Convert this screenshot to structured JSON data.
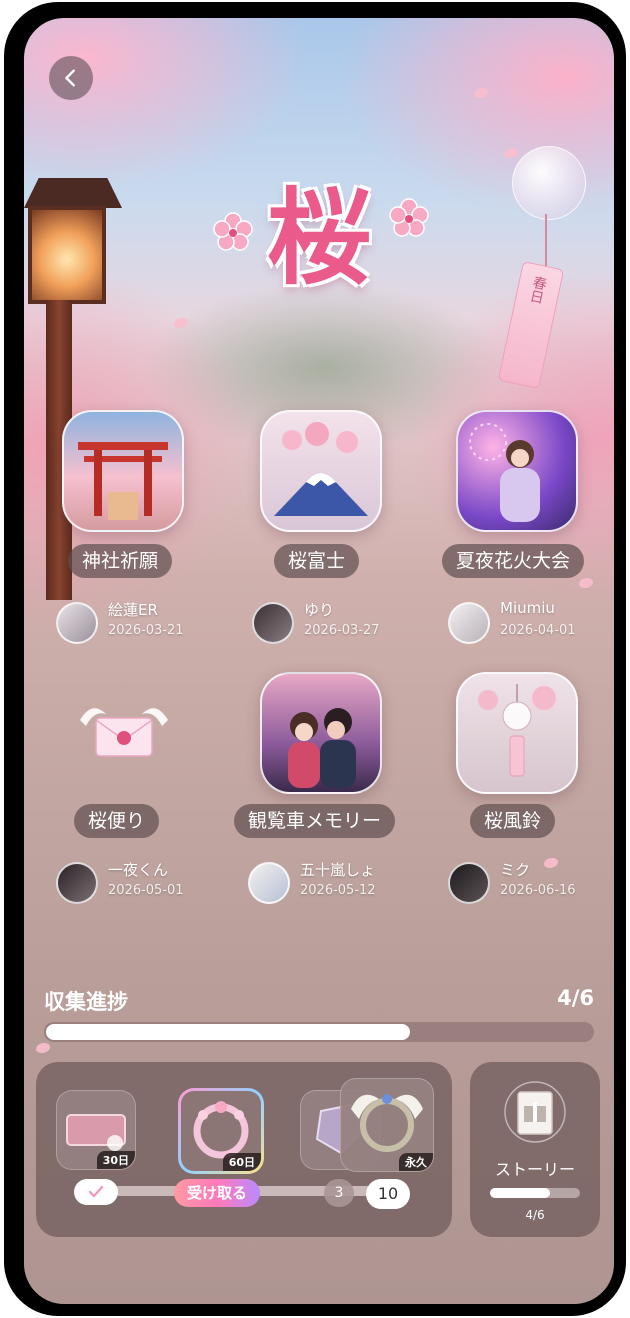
{
  "logo": {
    "text": "桜"
  },
  "decoration": {
    "tanzaku_text": "春日"
  },
  "items": [
    {
      "name": "神社祈願",
      "owner": "絵蓮ER",
      "date": "2026-03-21",
      "icon": "torii-gate-icon"
    },
    {
      "name": "桜富士",
      "owner": "ゆり",
      "date": "2026-03-27",
      "icon": "mount-fuji-icon"
    },
    {
      "name": "夏夜花火大会",
      "owner": "Miumiu",
      "date": "2026-04-01",
      "icon": "fireworks-yukata-icon"
    },
    {
      "name": "桜便り",
      "owner": "一夜くん",
      "date": "2026-05-01",
      "icon": "winged-letter-icon"
    },
    {
      "name": "観覧車メモリー",
      "owner": "五十嵐しょ",
      "date": "2026-05-12",
      "icon": "ferris-wheel-couple-icon"
    },
    {
      "name": "桜風鈴",
      "owner": "ミク",
      "date": "2026-06-16",
      "icon": "wind-chime-icon"
    }
  ],
  "progress": {
    "label": "収集進捗",
    "count": "4/6",
    "fraction": 0.667
  },
  "rewards": {
    "tiles": [
      {
        "days": "30日",
        "icon": "pink-nameplate-icon"
      },
      {
        "days": "60日",
        "icon": "sakura-avatar-frame-icon"
      },
      {
        "days": "",
        "icon": "crystal-frame-icon"
      },
      {
        "days": "永久",
        "icon": "angel-wing-frame-icon"
      }
    ],
    "claim_label": "受け取る",
    "node_3": "3",
    "node_10": "10"
  },
  "story": {
    "label": "ストーリー",
    "count": "4/6",
    "fraction": 0.667,
    "icon": "gift-book-icon"
  },
  "colors": {
    "accent": "#ea5b8b",
    "panel": "#6e5a5a",
    "claim_gradient_start": "#ff9aa4",
    "claim_gradient_end": "#b98aff"
  }
}
